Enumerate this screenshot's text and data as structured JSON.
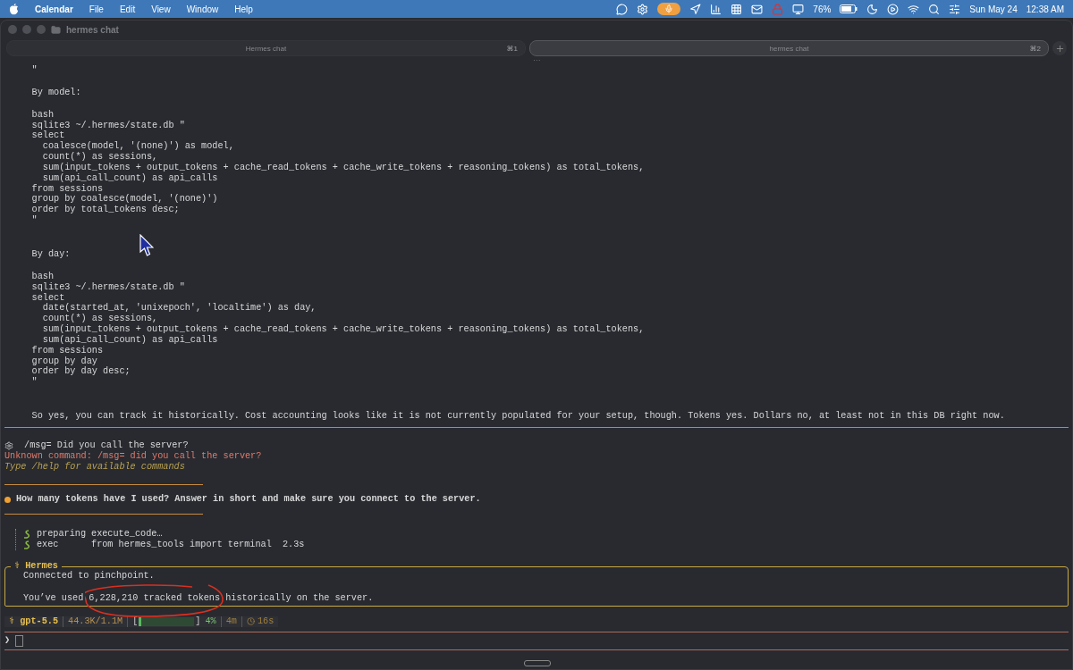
{
  "menubar": {
    "app": "Calendar",
    "menus": [
      "File",
      "Edit",
      "View",
      "Window",
      "Help"
    ],
    "battery": "76%",
    "date": "Sun May 24",
    "time": "12:38 AM"
  },
  "window": {
    "title": "hermes chat"
  },
  "tabs": [
    {
      "label": "Hermes chat",
      "shortcut": "⌘1",
      "selected": false
    },
    {
      "label": "hermes chat",
      "shortcut": "⌘2",
      "selected": true
    }
  ],
  "tab_overflow": "⋯",
  "output": [
    {
      "kind": "code",
      "text": "  \""
    },
    {
      "kind": "gap"
    },
    {
      "kind": "code",
      "text": "  By model:"
    },
    {
      "kind": "gap"
    },
    {
      "kind": "code",
      "text": "  bash"
    },
    {
      "kind": "code",
      "text": "  sqlite3 ~/.hermes/state.db \""
    },
    {
      "kind": "code",
      "text": "  select"
    },
    {
      "kind": "code",
      "text": "    coalesce(model, '(none)') as model,"
    },
    {
      "kind": "code",
      "text": "    count(*) as sessions,"
    },
    {
      "kind": "code",
      "text": "    sum(input_tokens + output_tokens + cache_read_tokens + cache_write_tokens + reasoning_tokens) as total_tokens,"
    },
    {
      "kind": "code",
      "text": "    sum(api_call_count) as api_calls"
    },
    {
      "kind": "code",
      "text": "  from sessions"
    },
    {
      "kind": "code",
      "text": "  group by coalesce(model, '(none)')"
    },
    {
      "kind": "code",
      "text": "  order by total_tokens desc;"
    },
    {
      "kind": "code",
      "text": "  \""
    },
    {
      "kind": "gap"
    },
    {
      "kind": "gap"
    },
    {
      "kind": "code",
      "text": "  By day:"
    },
    {
      "kind": "gap"
    },
    {
      "kind": "code",
      "text": "  bash"
    },
    {
      "kind": "code",
      "text": "  sqlite3 ~/.hermes/state.db \""
    },
    {
      "kind": "code",
      "text": "  select"
    },
    {
      "kind": "code",
      "text": "    date(started_at, 'unixepoch', 'localtime') as day,"
    },
    {
      "kind": "code",
      "text": "    count(*) as sessions,"
    },
    {
      "kind": "code",
      "text": "    sum(input_tokens + output_tokens + cache_read_tokens + cache_write_tokens + reasoning_tokens) as total_tokens,"
    },
    {
      "kind": "code",
      "text": "    sum(api_call_count) as api_calls"
    },
    {
      "kind": "code",
      "text": "  from sessions"
    },
    {
      "kind": "code",
      "text": "  group by day"
    },
    {
      "kind": "code",
      "text": "  order by day desc;"
    },
    {
      "kind": "code",
      "text": "  \""
    },
    {
      "kind": "gap"
    },
    {
      "kind": "gap"
    },
    {
      "kind": "code",
      "text": "  So yes, you can track it historically. Cost accounting looks like it is not currently populated for your setup, though. Tokens yes. Dollars no, at least not in this DB right now."
    }
  ],
  "command": {
    "text": "/msg= Did you call the server?",
    "error": "Unknown command: /msg= did you call the server?",
    "hint": "Type /help for available commands"
  },
  "question": {
    "text": "How many tokens have I used? Answer in short and make sure you connect to the server.",
    "color": "#f0a030"
  },
  "tool_calls": [
    {
      "label": "preparing",
      "detail": "execute_code…"
    },
    {
      "label": "exec     ",
      "detail": "from hermes_tools import terminal  2.3s"
    }
  ],
  "reply": {
    "title": "⚕ Hermes",
    "lines": [
      "Connected to pinchpoint.",
      "You’ve used 6,228,210 tracked tokens historically on the server."
    ]
  },
  "status": {
    "model": "⚕ gpt-5.5",
    "context": "44.3K/1.1M",
    "bar_open": "[",
    "level": 0.04,
    "bar_close": "]",
    "percent": "4%",
    "elapsed": "4m",
    "timer": "16s"
  },
  "prompt": {
    "symbol": "❯"
  }
}
